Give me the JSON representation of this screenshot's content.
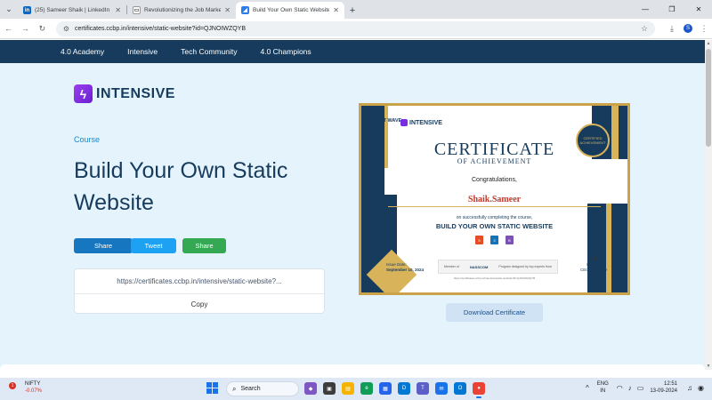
{
  "browser": {
    "tabs": [
      {
        "title": "(25) Sameer Shaik | LinkedIn",
        "favicon": "linkedin-icon",
        "active": false
      },
      {
        "title": "Revolutionizing the Job Market",
        "favicon": "page-icon",
        "active": false
      },
      {
        "title": "Build Your Own Static Website",
        "favicon": "ccbp-icon",
        "active": true
      }
    ],
    "new_tab": "+",
    "address": "certificates.ccbp.in/intensive/static-website?id=QJNOIWZQYB",
    "profile_initial": "S"
  },
  "site_nav": {
    "items": [
      "4.0 Academy",
      "Intensive",
      "Tech Community",
      "4.0 Champions"
    ]
  },
  "brand": {
    "logo_text": "INTENSIVE"
  },
  "course": {
    "label": "Course",
    "title": "Build Your Own Static Website"
  },
  "share": {
    "linkedin_label": "Share",
    "twitter_label": "Tweet",
    "whatsapp_label": "Share"
  },
  "link_card": {
    "url": "https://certificates.ccbp.in/intensive/static-website?...",
    "copy_label": "Copy"
  },
  "certificate": {
    "brand_a": "NXT WAVE",
    "brand_b": "INTENSIVE",
    "seal_text": "CERTIFIED ACHIEVEMENT",
    "heading": "CERTIFICATE",
    "subheading": "OF ACHIEVEMENT",
    "congrats": "Congratulations,",
    "recipient": "Shaik.Sameer",
    "completed_text": "on successfully completing the course,",
    "course_title": "BUILD YOUR OWN STATIC WEBSITE",
    "technologies": [
      "HTML",
      "CSS",
      "Bootstrap"
    ],
    "issue_label": "Issue Date:",
    "issue_date": "September 10, 2024",
    "partner_label": "Member of",
    "partner_name": "NASSCOM",
    "curriculum_label": "Program designed by top experts from",
    "signatory_name": "Rahul A",
    "signatory_role": "CEO, NxtWave",
    "verify_text": "https://certificates.ccbp.in/intensive/static-website?id=QJNOIWZQYB"
  },
  "download_label": "Download Certificate",
  "taskbar": {
    "stock_name": "NIFTY",
    "stock_change": "-0.07%",
    "stock_badge": "1",
    "search_placeholder": "Search",
    "lang_top": "ENG",
    "lang_bottom": "IN",
    "time": "12:51",
    "date": "13-09-2024"
  },
  "colors": {
    "nav_bg": "#163b5c",
    "content_bg": "#e5f4fc",
    "accent": "#1b86c9",
    "certificate_gold": "#c9a24a"
  }
}
